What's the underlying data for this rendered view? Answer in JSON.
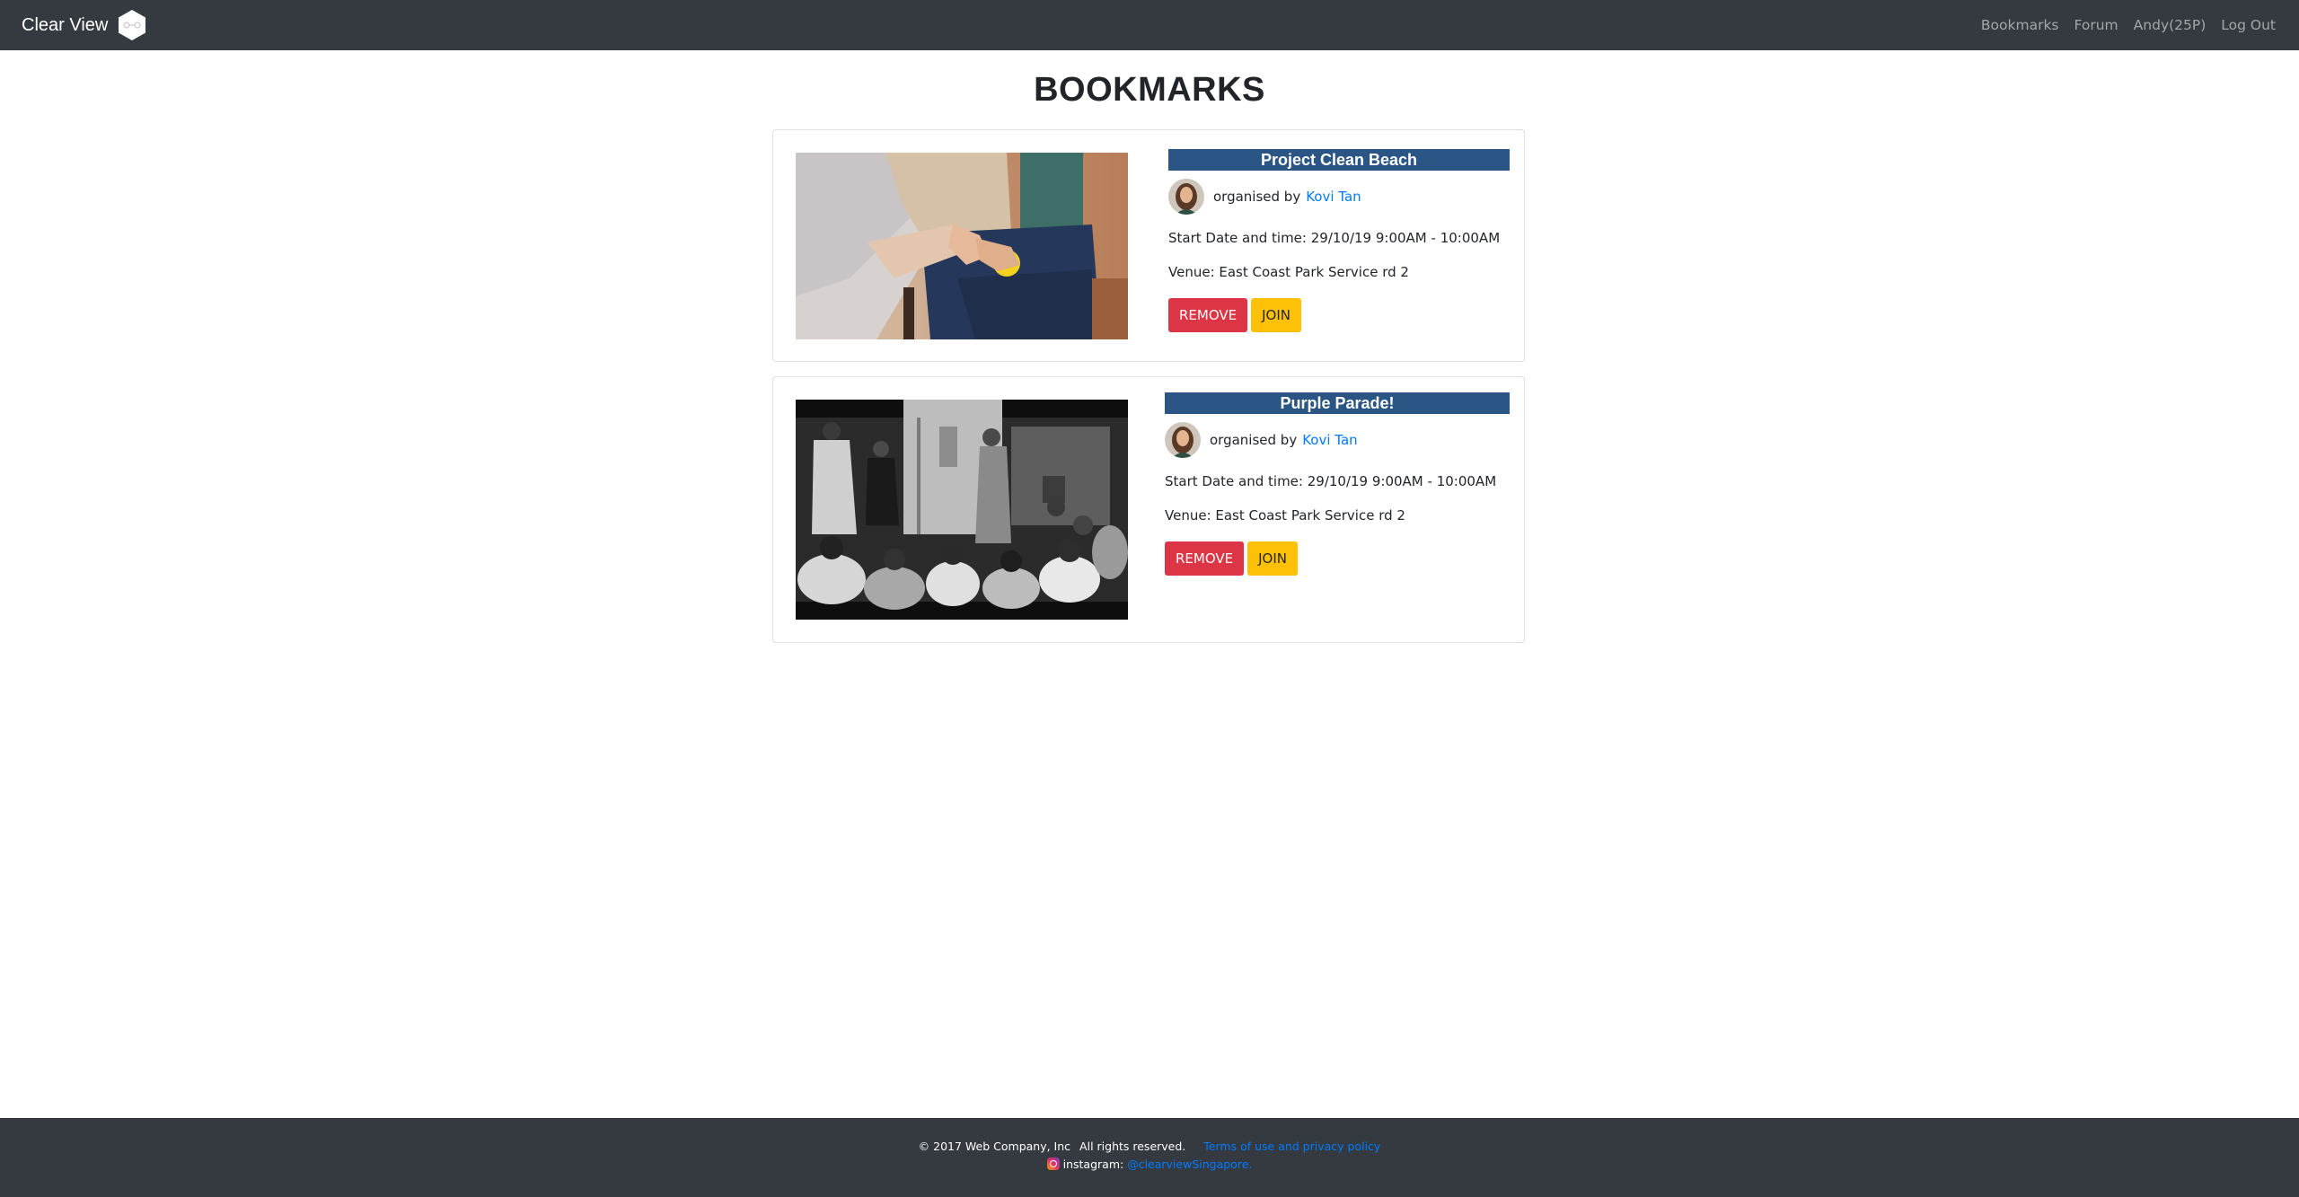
{
  "navbar": {
    "brand": "Clear View",
    "links": [
      {
        "label": "Bookmarks"
      },
      {
        "label": "Forum"
      },
      {
        "label": "Andy(25P)"
      },
      {
        "label": "Log Out"
      }
    ]
  },
  "page": {
    "title": "BOOKMARKS"
  },
  "bookmarks": [
    {
      "title": "Project Clean Beach",
      "organised_by_label": "organised by",
      "organiser": "Kovi Tan",
      "start": "Start Date and time: 29/10/19 9:00AM - 10:00AM",
      "venue": "Venue: East Coast Park Service rd 2",
      "remove_label": "REMOVE",
      "join_label": "JOIN"
    },
    {
      "title": "Purple Parade!",
      "organised_by_label": "organised by",
      "organiser": "Kovi Tan",
      "start": "Start Date and time: 29/10/19 9:00AM - 10:00AM",
      "venue": "Venue: East Coast Park Service rd 2",
      "remove_label": "REMOVE",
      "join_label": "JOIN"
    }
  ],
  "footer": {
    "copyright": "© 2017 Web Company, Inc",
    "rights": "All rights reserved.",
    "terms_link": "Terms of use and privacy policy",
    "instagram_label": "instagram:",
    "instagram_handle": "@clearviewSingapore."
  },
  "colors": {
    "navbar_bg": "#343a40",
    "title_banner": "#2a5584",
    "remove_button": "#dc3545",
    "join_button": "#ffc107",
    "link": "#007bff"
  }
}
